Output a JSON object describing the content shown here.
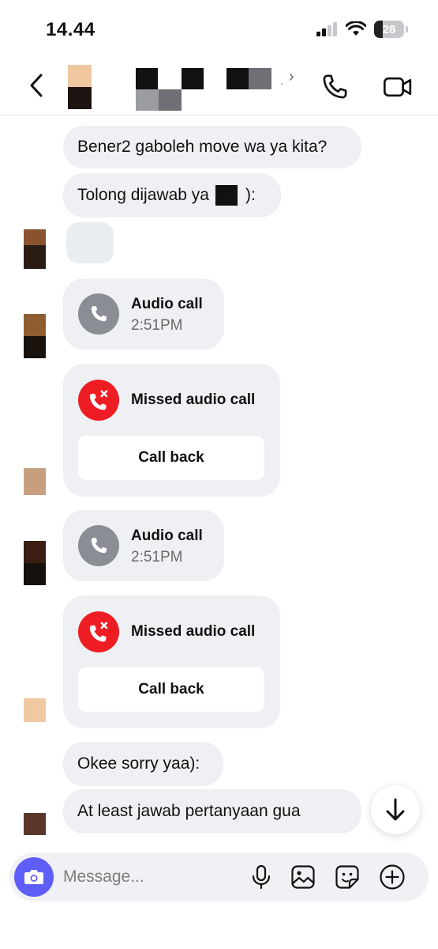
{
  "status_bar": {
    "time": "14.44",
    "battery": "28"
  },
  "header": {
    "contact_name": "",
    "chevron": "›",
    "dot": "."
  },
  "messages": [
    {
      "text": "Bener2 gaboleh move wa ya kita?"
    },
    {
      "text_before": "Tolong dijawab ya",
      "text_after": "):"
    },
    {
      "text": ""
    },
    {
      "text": "Okee sorry yaa):"
    },
    {
      "text": "At least jawab pertanyaan gua"
    }
  ],
  "calls": [
    {
      "type": "audio",
      "title": "Audio call",
      "time": "2:51PM"
    },
    {
      "type": "missed",
      "title": "Missed audio call",
      "action": "Call back"
    },
    {
      "type": "audio",
      "title": "Audio call",
      "time": "2:51PM"
    },
    {
      "type": "missed",
      "title": "Missed audio call",
      "action": "Call back"
    }
  ],
  "composer": {
    "placeholder": "Message..."
  },
  "colors": {
    "accent": "#5f5ef8",
    "missed": "#ee1d23",
    "call_gray": "#8a8d93",
    "bubble": "#eef0f3"
  },
  "icons": [
    "back-chevron-icon",
    "phone-icon",
    "video-icon",
    "camera-icon",
    "microphone-icon",
    "image-icon",
    "sticker-icon",
    "plus-icon",
    "arrow-down-icon",
    "missed-call-icon"
  ]
}
